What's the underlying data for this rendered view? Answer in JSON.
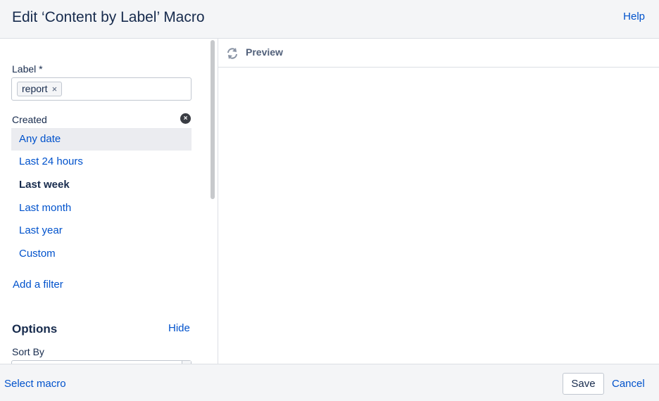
{
  "header": {
    "title": "Edit ‘Content by Label’ Macro",
    "help_label": "Help"
  },
  "filters": {
    "label_field_label": "Label *",
    "label_chips": [
      "report"
    ],
    "chip_remove_glyph": "×",
    "created_label": "Created",
    "clear_glyph": "×",
    "date_options": [
      {
        "label": "Any date",
        "state": "hover"
      },
      {
        "label": "Last 24 hours",
        "state": "normal"
      },
      {
        "label": "Last week",
        "state": "selected"
      },
      {
        "label": "Last month",
        "state": "normal"
      },
      {
        "label": "Last year",
        "state": "normal"
      },
      {
        "label": "Custom",
        "state": "normal"
      }
    ],
    "add_filter_label": "Add a filter"
  },
  "options": {
    "title": "Options",
    "hide_label": "Hide",
    "sort_by_label": "Sort By",
    "sort_by_value": ""
  },
  "preview": {
    "label": "Preview",
    "icon": "refresh-icon"
  },
  "footer": {
    "select_macro_label": "Select macro",
    "save_label": "Save",
    "cancel_label": "Cancel"
  },
  "colors": {
    "link": "#0052cc",
    "text": "#172b4d",
    "header_bg": "#f4f5f7",
    "hover_bg": "#ebecf0"
  }
}
